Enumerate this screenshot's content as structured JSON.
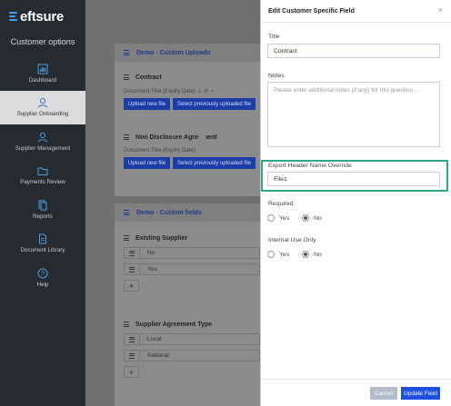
{
  "brand": {
    "name": "eftsure"
  },
  "sidebar": {
    "heading": "Customer options",
    "items": [
      {
        "label": "Dashboard",
        "icon": "dashboard-icon"
      },
      {
        "label": "Supplier Onboarding",
        "icon": "user-icon",
        "active": true
      },
      {
        "label": "Supplier Management",
        "icon": "users-icon"
      },
      {
        "label": "Payments Review",
        "icon": "folder-icon"
      },
      {
        "label": "Reports",
        "icon": "report-icon"
      },
      {
        "label": "Document Library",
        "icon": "document-icon"
      },
      {
        "label": "Help",
        "icon": "help-icon"
      }
    ]
  },
  "main": {
    "uploads_section": {
      "title": "Demo - Custom Uploads",
      "items": [
        {
          "title": "Contract",
          "subtitle": "Document Title (Expiry Date)",
          "upload_label": "Upload new file",
          "select_label": "Select previously uploaded file"
        },
        {
          "title": "Non Disclosure Agreement",
          "subtitle": "Document Title (Expiry Date)",
          "upload_label": "Upload new file",
          "select_label": "Select previously uploaded file"
        }
      ]
    },
    "fields_section": {
      "title": "Demo - Custom fields",
      "fields": [
        {
          "title": "Existing Supplier",
          "options": [
            "No",
            "Yes"
          ]
        },
        {
          "title": "Supplier Agreement Type",
          "options": [
            "Local",
            "National"
          ]
        }
      ],
      "add_label": "+"
    }
  },
  "panel": {
    "title": "Edit Customer Specific Field",
    "close_label": "×",
    "title_label": "Title",
    "title_value": "Contract",
    "notes_label": "Notes",
    "notes_placeholder": "Please enter additional notes (if any) for this question...",
    "export_label": "Export Header Name Override",
    "export_value": "File1",
    "required_label": "Required",
    "required_options": [
      "Yes",
      "No"
    ],
    "required_selected": "No",
    "internal_label": "Internal Use Only",
    "internal_options": [
      "Yes",
      "No"
    ],
    "internal_selected": "No",
    "cancel_label": "Cancel",
    "update_label": "Update Field"
  },
  "colors": {
    "accent": "#1d4fe0",
    "highlight": "#2fa88a",
    "sidebar_bg": "#262b30"
  }
}
